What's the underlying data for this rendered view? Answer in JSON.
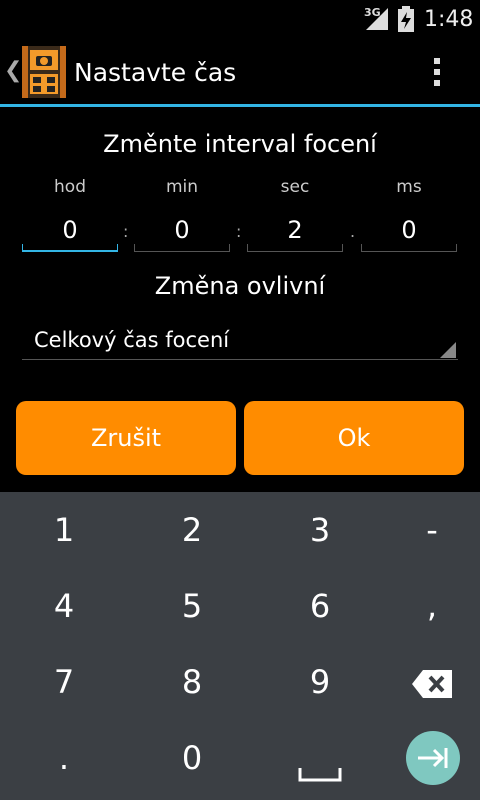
{
  "status_bar": {
    "network": "3G",
    "time": "1:48"
  },
  "action_bar": {
    "title": "Nastavte čas"
  },
  "dialog": {
    "heading": "Změnte interval focení",
    "units": [
      "hod",
      "min",
      "sec",
      "ms"
    ],
    "values": [
      "0",
      "0",
      "2",
      "0"
    ],
    "separators": [
      ":",
      ":",
      "."
    ],
    "subheading": "Změna ovlivní",
    "spinner_value": "Celkový čas focení",
    "cancel_label": "Zrušit",
    "ok_label": "Ok"
  },
  "keyboard": {
    "row1": [
      "1",
      "2",
      "3",
      "-"
    ],
    "row2": [
      "4",
      "5",
      "6",
      ","
    ],
    "row3": [
      "7",
      "8",
      "9"
    ],
    "row4": [
      ".",
      "0"
    ],
    "icons": {
      "backspace": "backspace-icon",
      "space": "space-icon",
      "next": "next-icon"
    }
  },
  "colors": {
    "accent": "#33b5e5",
    "button": "#ff8c00",
    "keyboard_bg": "#3b3f44",
    "enter_key": "#7fc8c0"
  }
}
